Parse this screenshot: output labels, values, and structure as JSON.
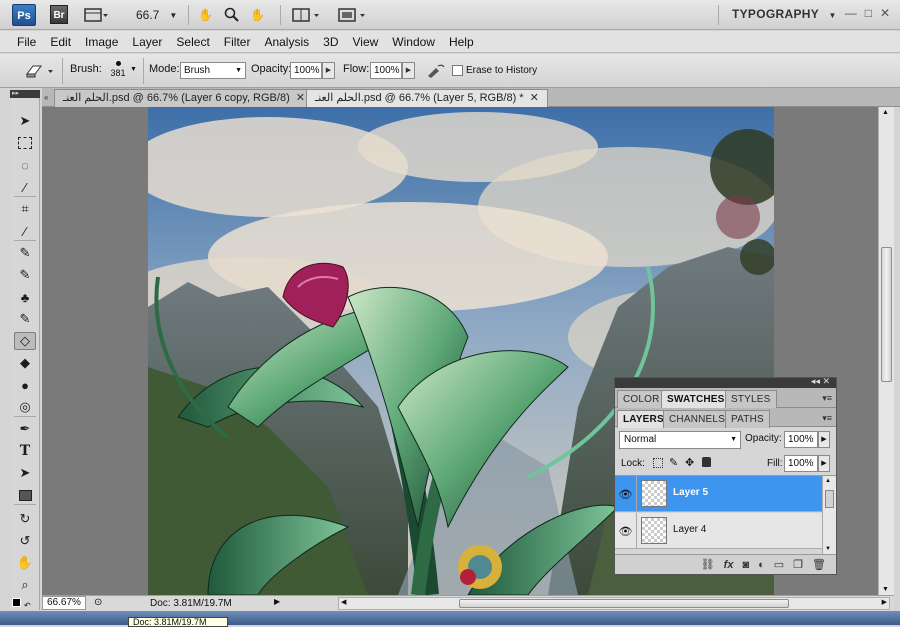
{
  "appbar": {
    "ps_logo": "Ps",
    "br_logo": "Br",
    "zoom": "66.7",
    "workspace": "TYPOGRAPHY"
  },
  "menu": [
    "File",
    "Edit",
    "Image",
    "Layer",
    "Select",
    "Filter",
    "Analysis",
    "3D",
    "View",
    "Window",
    "Help"
  ],
  "options": {
    "brush_label": "Brush:",
    "brush_size": "381",
    "mode_label": "Mode:",
    "mode_value": "Brush",
    "opacity_label": "Opacity:",
    "opacity_value": "100%",
    "flow_label": "Flow:",
    "flow_value": "100%",
    "erase_history_label": "Erase to History"
  },
  "tabs": [
    {
      "label": "الحلم العنـ.psd @ 66.7% (Layer 6 copy, RGB/8)",
      "active": false
    },
    {
      "label": "الحلم العنـ.psd @ 66.7% (Layer 5, RGB/8) *",
      "active": true
    }
  ],
  "status": {
    "zoom": "66.67%",
    "doc": "Doc: 3.81M/19.7M",
    "tooltip": "Doc: 3.81M/19.7M"
  },
  "panel": {
    "top_tabs": [
      "COLOR",
      "SWATCHES",
      "STYLES"
    ],
    "active_top_tab": "SWATCHES",
    "layer_tabs": [
      "LAYERS",
      "CHANNELS",
      "PATHS"
    ],
    "active_layer_tab": "LAYERS",
    "blend_mode": "Normal",
    "opacity_label": "Opacity:",
    "opacity_value": "100%",
    "lock_label": "Lock:",
    "fill_label": "Fill:",
    "fill_value": "100%",
    "layers": [
      {
        "name": "Layer 5",
        "selected": true
      },
      {
        "name": "Layer 4",
        "selected": false
      }
    ]
  },
  "colors": {
    "selection_blue": "#3d95f0",
    "ps_blue": "#2f67aa",
    "panel_dark": "#3b3b3b"
  }
}
